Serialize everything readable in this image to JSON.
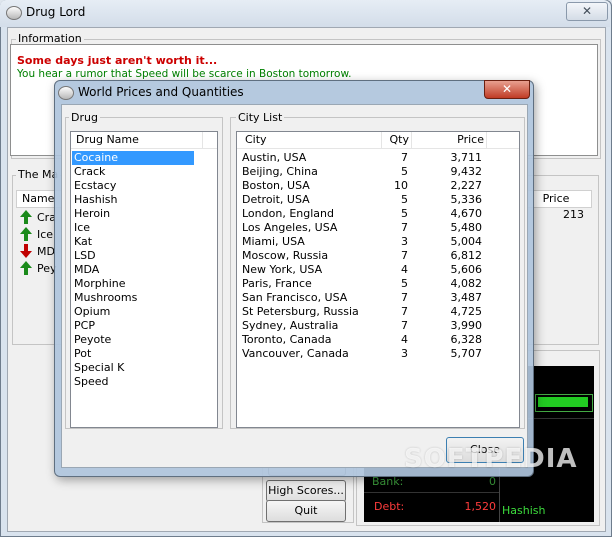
{
  "window": {
    "title": "Drug Lord",
    "close_glyph": "✕"
  },
  "information": {
    "label": "Information",
    "headline": "Some days just aren't worth it...",
    "rumor": "You hear a rumor that Speed will be scarce in Boston tomorrow."
  },
  "market": {
    "label": "The Ma",
    "name_header": "Name",
    "price_header": "Price",
    "rows": [
      {
        "name": "Cra",
        "trend": "up"
      },
      {
        "name": "Ice",
        "trend": "up"
      },
      {
        "name": "MD",
        "trend": "down"
      },
      {
        "name": "Pey",
        "trend": "up"
      }
    ],
    "first_price": "213"
  },
  "buttons": {
    "high_scores": "High Scores...",
    "quit": "Quit"
  },
  "status": {
    "bank_label": "Bank:",
    "bank_value": "0",
    "debt_label": "Debt:",
    "debt_value": "1,520",
    "hashish_label": "Hashish",
    "colors": {
      "bank": "#3c9c3c",
      "debt": "#ff3c3c",
      "bar": "#22cc22"
    }
  },
  "dialog": {
    "title": "World Prices and Quantities",
    "close_glyph": "✕",
    "drug_group": "Drug",
    "drug_header": "Drug Name",
    "drugs": [
      "Cocaine",
      "Crack",
      "Ecstacy",
      "Hashish",
      "Heroin",
      "Ice",
      "Kat",
      "LSD",
      "MDA",
      "Morphine",
      "Mushrooms",
      "Opium",
      "PCP",
      "Peyote",
      "Pot",
      "Special K",
      "Speed"
    ],
    "selected_drug": "Cocaine",
    "city_group": "City List",
    "city_headers": {
      "city": "City",
      "qty": "Qty",
      "price": "Price"
    },
    "cities": [
      {
        "city": "Austin, USA",
        "qty": "7",
        "price": "3,711"
      },
      {
        "city": "Beijing, China",
        "qty": "5",
        "price": "9,432"
      },
      {
        "city": "Boston, USA",
        "qty": "10",
        "price": "2,227"
      },
      {
        "city": "Detroit, USA",
        "qty": "5",
        "price": "5,336"
      },
      {
        "city": "London, England",
        "qty": "5",
        "price": "4,670"
      },
      {
        "city": "Los Angeles, USA",
        "qty": "7",
        "price": "5,480"
      },
      {
        "city": "Miami, USA",
        "qty": "3",
        "price": "5,004"
      },
      {
        "city": "Moscow, Russia",
        "qty": "7",
        "price": "6,812"
      },
      {
        "city": "New York, USA",
        "qty": "4",
        "price": "5,606"
      },
      {
        "city": "Paris, France",
        "qty": "5",
        "price": "4,082"
      },
      {
        "city": "San Francisco, USA",
        "qty": "7",
        "price": "3,487"
      },
      {
        "city": "St Petersburg, Russia",
        "qty": "7",
        "price": "4,725"
      },
      {
        "city": "Sydney, Australia",
        "qty": "7",
        "price": "3,990"
      },
      {
        "city": "Toronto, Canada",
        "qty": "4",
        "price": "6,328"
      },
      {
        "city": "Vancouver, Canada",
        "qty": "3",
        "price": "5,707"
      }
    ],
    "close_button": "Close"
  },
  "watermark": "SOFTPEDIA"
}
